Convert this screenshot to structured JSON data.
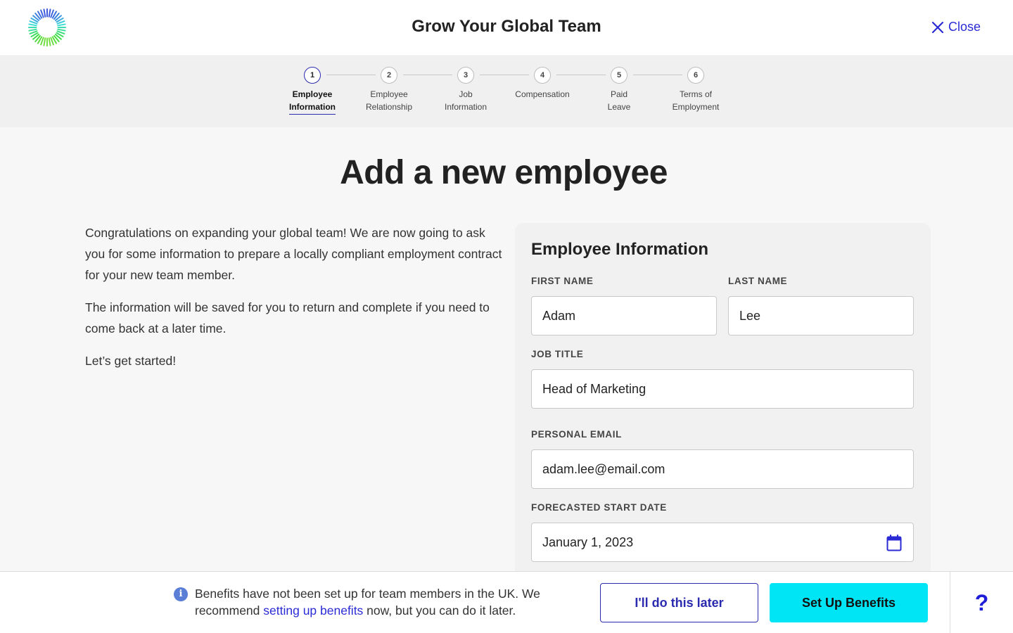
{
  "header": {
    "title": "Grow Your Global Team",
    "close_label": "Close"
  },
  "stepper": {
    "steps": [
      {
        "number": "1",
        "label_line1": "Employee",
        "label_line2": "Information",
        "active": true
      },
      {
        "number": "2",
        "label_line1": "Employee",
        "label_line2": "Relationship",
        "active": false
      },
      {
        "number": "3",
        "label_line1": "Job",
        "label_line2": "Information",
        "active": false
      },
      {
        "number": "4",
        "label_line1": "Compensation",
        "label_line2": "",
        "active": false
      },
      {
        "number": "5",
        "label_line1": "Paid",
        "label_line2": "Leave",
        "active": false
      },
      {
        "number": "6",
        "label_line1": "Terms of",
        "label_line2": "Employment",
        "active": false
      }
    ]
  },
  "main": {
    "title": "Add a new employee",
    "intro": [
      "Congratulations on expanding your global team!  We are now going to ask you for some information to prepare a locally compliant employment contract for your new team member.",
      "The information will be saved for you to return and complete if you need to come back at a later time.",
      "Let’s get started!"
    ]
  },
  "form": {
    "title": "Employee Information",
    "first_name_label": "FIRST NAME",
    "first_name_value": "Adam",
    "last_name_label": "LAST NAME",
    "last_name_value": "Lee",
    "job_title_label": "JOB TITLE",
    "job_title_value": "Head of Marketing",
    "email_label": "PERSONAL EMAIL",
    "email_value": "adam.lee@email.com",
    "start_date_label": "FORECASTED START DATE",
    "start_date_value": "January 1, 2023"
  },
  "footer": {
    "notice_part1": "Benefits have not been set up for team members in the UK. We recommend ",
    "notice_link": "setting up benefits",
    "notice_part2": " now, but you can do it later.",
    "later_label": "I'll do this later",
    "setup_label": "Set Up Benefits",
    "help_label": "?"
  },
  "colors": {
    "accent": "#2b2bd6",
    "cta": "#00e5f5",
    "info": "#5b7fd6"
  },
  "icons": [
    "logo-icon",
    "close-icon",
    "calendar-icon",
    "info-icon",
    "help-icon"
  ]
}
